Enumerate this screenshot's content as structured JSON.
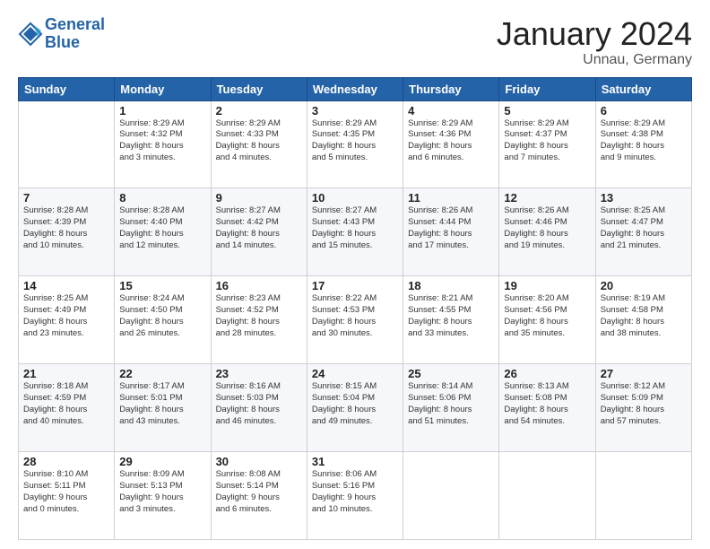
{
  "header": {
    "logo_line1": "General",
    "logo_line2": "Blue",
    "main_title": "January 2024",
    "subtitle": "Unnau, Germany"
  },
  "calendar": {
    "weekdays": [
      "Sunday",
      "Monday",
      "Tuesday",
      "Wednesday",
      "Thursday",
      "Friday",
      "Saturday"
    ],
    "weeks": [
      [
        {
          "day": "",
          "info": ""
        },
        {
          "day": "1",
          "info": "Sunrise: 8:29 AM\nSunset: 4:32 PM\nDaylight: 8 hours\nand 3 minutes."
        },
        {
          "day": "2",
          "info": "Sunrise: 8:29 AM\nSunset: 4:33 PM\nDaylight: 8 hours\nand 4 minutes."
        },
        {
          "day": "3",
          "info": "Sunrise: 8:29 AM\nSunset: 4:35 PM\nDaylight: 8 hours\nand 5 minutes."
        },
        {
          "day": "4",
          "info": "Sunrise: 8:29 AM\nSunset: 4:36 PM\nDaylight: 8 hours\nand 6 minutes."
        },
        {
          "day": "5",
          "info": "Sunrise: 8:29 AM\nSunset: 4:37 PM\nDaylight: 8 hours\nand 7 minutes."
        },
        {
          "day": "6",
          "info": "Sunrise: 8:29 AM\nSunset: 4:38 PM\nDaylight: 8 hours\nand 9 minutes."
        }
      ],
      [
        {
          "day": "7",
          "info": "Sunrise: 8:28 AM\nSunset: 4:39 PM\nDaylight: 8 hours\nand 10 minutes."
        },
        {
          "day": "8",
          "info": "Sunrise: 8:28 AM\nSunset: 4:40 PM\nDaylight: 8 hours\nand 12 minutes."
        },
        {
          "day": "9",
          "info": "Sunrise: 8:27 AM\nSunset: 4:42 PM\nDaylight: 8 hours\nand 14 minutes."
        },
        {
          "day": "10",
          "info": "Sunrise: 8:27 AM\nSunset: 4:43 PM\nDaylight: 8 hours\nand 15 minutes."
        },
        {
          "day": "11",
          "info": "Sunrise: 8:26 AM\nSunset: 4:44 PM\nDaylight: 8 hours\nand 17 minutes."
        },
        {
          "day": "12",
          "info": "Sunrise: 8:26 AM\nSunset: 4:46 PM\nDaylight: 8 hours\nand 19 minutes."
        },
        {
          "day": "13",
          "info": "Sunrise: 8:25 AM\nSunset: 4:47 PM\nDaylight: 8 hours\nand 21 minutes."
        }
      ],
      [
        {
          "day": "14",
          "info": "Sunrise: 8:25 AM\nSunset: 4:49 PM\nDaylight: 8 hours\nand 23 minutes."
        },
        {
          "day": "15",
          "info": "Sunrise: 8:24 AM\nSunset: 4:50 PM\nDaylight: 8 hours\nand 26 minutes."
        },
        {
          "day": "16",
          "info": "Sunrise: 8:23 AM\nSunset: 4:52 PM\nDaylight: 8 hours\nand 28 minutes."
        },
        {
          "day": "17",
          "info": "Sunrise: 8:22 AM\nSunset: 4:53 PM\nDaylight: 8 hours\nand 30 minutes."
        },
        {
          "day": "18",
          "info": "Sunrise: 8:21 AM\nSunset: 4:55 PM\nDaylight: 8 hours\nand 33 minutes."
        },
        {
          "day": "19",
          "info": "Sunrise: 8:20 AM\nSunset: 4:56 PM\nDaylight: 8 hours\nand 35 minutes."
        },
        {
          "day": "20",
          "info": "Sunrise: 8:19 AM\nSunset: 4:58 PM\nDaylight: 8 hours\nand 38 minutes."
        }
      ],
      [
        {
          "day": "21",
          "info": "Sunrise: 8:18 AM\nSunset: 4:59 PM\nDaylight: 8 hours\nand 40 minutes."
        },
        {
          "day": "22",
          "info": "Sunrise: 8:17 AM\nSunset: 5:01 PM\nDaylight: 8 hours\nand 43 minutes."
        },
        {
          "day": "23",
          "info": "Sunrise: 8:16 AM\nSunset: 5:03 PM\nDaylight: 8 hours\nand 46 minutes."
        },
        {
          "day": "24",
          "info": "Sunrise: 8:15 AM\nSunset: 5:04 PM\nDaylight: 8 hours\nand 49 minutes."
        },
        {
          "day": "25",
          "info": "Sunrise: 8:14 AM\nSunset: 5:06 PM\nDaylight: 8 hours\nand 51 minutes."
        },
        {
          "day": "26",
          "info": "Sunrise: 8:13 AM\nSunset: 5:08 PM\nDaylight: 8 hours\nand 54 minutes."
        },
        {
          "day": "27",
          "info": "Sunrise: 8:12 AM\nSunset: 5:09 PM\nDaylight: 8 hours\nand 57 minutes."
        }
      ],
      [
        {
          "day": "28",
          "info": "Sunrise: 8:10 AM\nSunset: 5:11 PM\nDaylight: 9 hours\nand 0 minutes."
        },
        {
          "day": "29",
          "info": "Sunrise: 8:09 AM\nSunset: 5:13 PM\nDaylight: 9 hours\nand 3 minutes."
        },
        {
          "day": "30",
          "info": "Sunrise: 8:08 AM\nSunset: 5:14 PM\nDaylight: 9 hours\nand 6 minutes."
        },
        {
          "day": "31",
          "info": "Sunrise: 8:06 AM\nSunset: 5:16 PM\nDaylight: 9 hours\nand 10 minutes."
        },
        {
          "day": "",
          "info": ""
        },
        {
          "day": "",
          "info": ""
        },
        {
          "day": "",
          "info": ""
        }
      ]
    ]
  }
}
